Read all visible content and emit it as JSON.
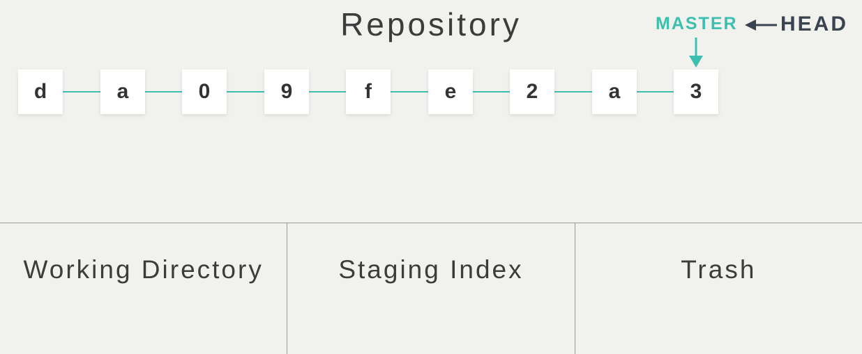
{
  "repository": {
    "title": "Repository",
    "commits": [
      "d",
      "a",
      "0",
      "9",
      "f",
      "e",
      "2",
      "a",
      "3"
    ]
  },
  "pointers": {
    "master": "MASTER",
    "head": "HEAD"
  },
  "areas": {
    "working_directory": "Working Directory",
    "staging_index": "Staging Index",
    "trash": "Trash"
  },
  "colors": {
    "accent": "#3dbfb0",
    "head": "#3a4350",
    "background": "#f1f1ee"
  }
}
